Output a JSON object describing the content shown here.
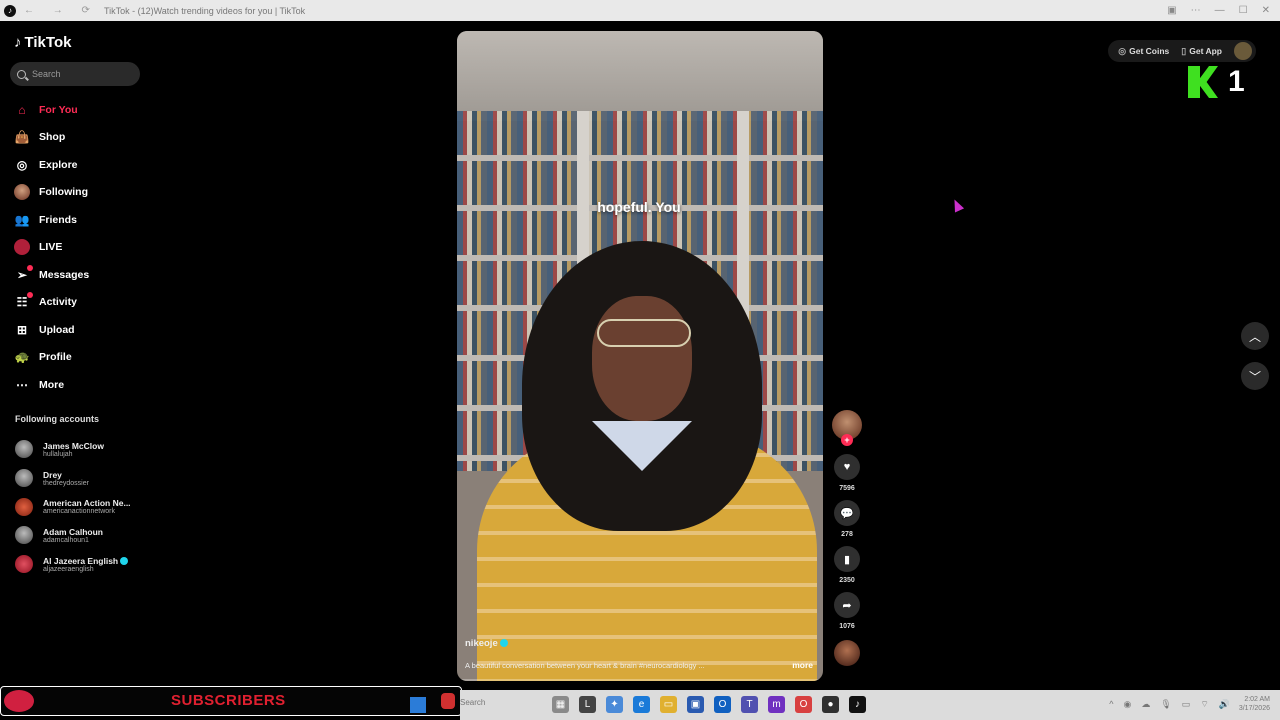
{
  "window": {
    "title": "TikTok - (12)Watch trending videos for you | TikTok"
  },
  "sidebar": {
    "logo": "TikTok",
    "search_placeholder": "Search",
    "items": [
      {
        "label": "For You",
        "icon": "home-icon"
      },
      {
        "label": "Shop",
        "icon": "shopping-bag-icon"
      },
      {
        "label": "Explore",
        "icon": "compass-icon"
      },
      {
        "label": "Following",
        "icon": "avatar-icon"
      },
      {
        "label": "Friends",
        "icon": "friends-icon"
      },
      {
        "label": "LIVE",
        "icon": "live-icon"
      },
      {
        "label": "Messages",
        "icon": "paper-plane-icon"
      },
      {
        "label": "Activity",
        "icon": "activity-icon"
      },
      {
        "label": "Upload",
        "icon": "plus-square-icon"
      },
      {
        "label": "Profile",
        "icon": "profile-avatar-icon"
      },
      {
        "label": "More",
        "icon": "ellipsis-icon"
      }
    ],
    "following_title": "Following accounts",
    "accounts": [
      {
        "name": "James McClow",
        "handle": "hullalujah"
      },
      {
        "name": "Drey",
        "handle": "thedreydossier"
      },
      {
        "name": "American Action Ne...",
        "handle": "americanactionnetwork"
      },
      {
        "name": "Adam Calhoun",
        "handle": "adamcalhoun1"
      },
      {
        "name": "Al Jazeera English",
        "handle": "aljazeeraenglish"
      }
    ]
  },
  "video": {
    "caption": "hopeful. You",
    "author": "nikeoje",
    "description": "A beautiful conversation between your heart & brain #neurocardiology ...",
    "more": "more"
  },
  "actions": {
    "likes": "7596",
    "comments": "278",
    "saves": "2350",
    "shares": "1076"
  },
  "header": {
    "get_coins": "Get Coins",
    "get_app": "Get App"
  },
  "overlay": {
    "kick_count": "1",
    "subscribers": "SUBSCRIBERS"
  },
  "taskbar": {
    "search": "Search",
    "time": "2:02 AM",
    "date": "3/17/2026"
  }
}
